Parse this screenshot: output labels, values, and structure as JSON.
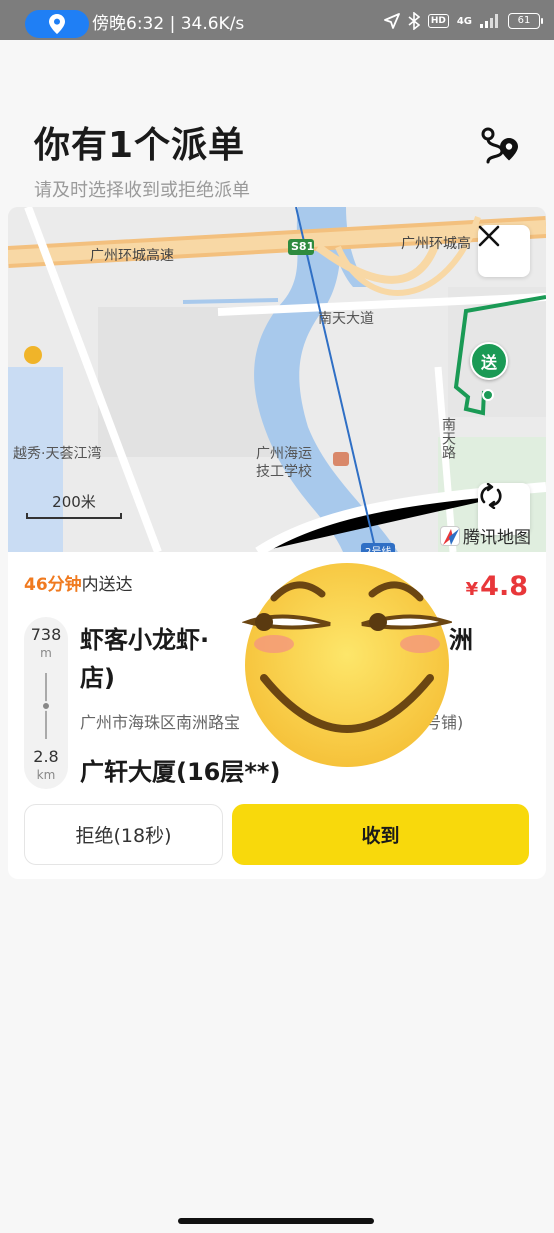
{
  "status_bar": {
    "time_speed": "傍晚6:32 | 34.6K/s",
    "hd_label": "HD",
    "network_label": "4G",
    "battery": "61",
    "icons": [
      "location-icon",
      "navigation-arrow-icon",
      "bluetooth-icon",
      "signal-icon",
      "battery-icon"
    ]
  },
  "header": {
    "title": "你有1个派单",
    "subtitle": "请及时选择收到或拒绝派单",
    "route_icon": "route-pin-icon"
  },
  "map": {
    "labels": {
      "ring_expressway_left": "广州环城高速",
      "ring_expressway_right": "广州环城高",
      "highway_shield": "S81",
      "road_nantian": "南天大道",
      "nantian_road": "南天路",
      "tianhui": "越秀·天荟江湾",
      "school": "广州海运\n技工学校",
      "metro": "2号线"
    },
    "scale": "200米",
    "provider": "腾讯地图",
    "delivery_pin": "送",
    "close_icon": "close-icon",
    "refresh_icon": "refresh-icon"
  },
  "order": {
    "deliver_minutes": "46分钟",
    "deliver_suffix": "内送达",
    "price_currency": "¥",
    "price": "4.8",
    "distance_to_shop_value": "738",
    "distance_to_shop_unit": "m",
    "distance_to_dest_value": "2.8",
    "distance_to_dest_unit": "km",
    "shop_name_line1": "虾客小龙虾·",
    "shop_name_line1_tail": "洲",
    "shop_name_line2": "店)",
    "shop_address": "广州市海珠区南洲路宝",
    "shop_address_tail": "号铺)",
    "destination": "广轩大厦(16层**)"
  },
  "actions": {
    "reject_label": "拒绝(18秒)",
    "accept_label": "收到"
  },
  "colors": {
    "accent_yellow": "#f8d90c",
    "price_red": "#e8373a",
    "time_orange": "#f07a1f",
    "route_green": "#1a9a55"
  }
}
